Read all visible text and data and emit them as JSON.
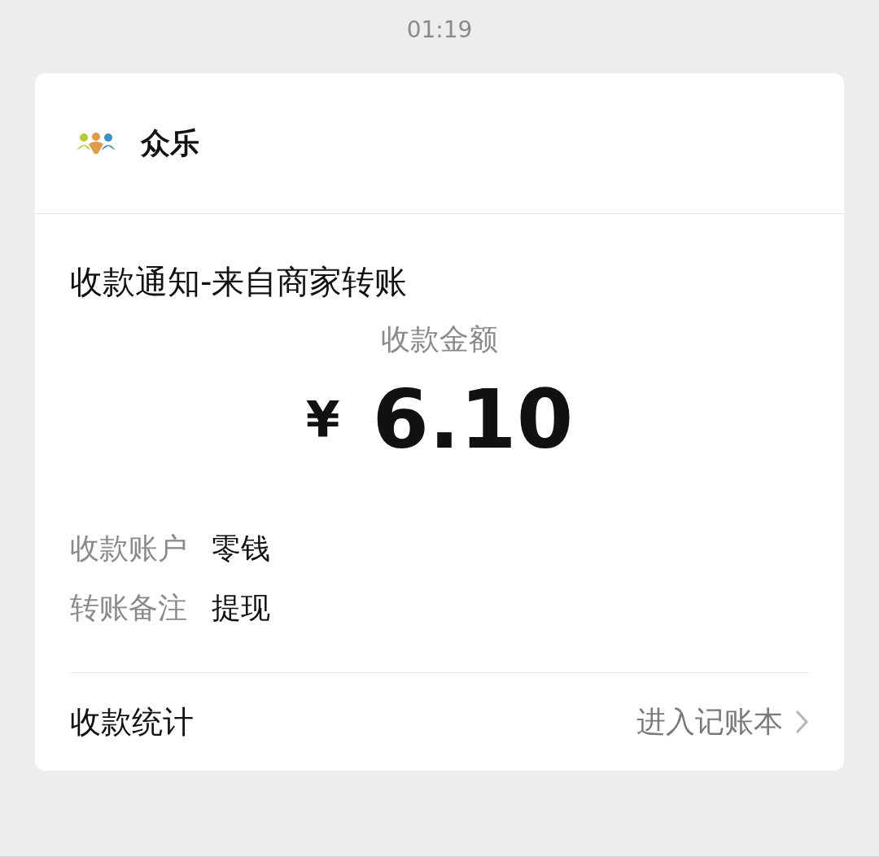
{
  "time": "01:19",
  "card": {
    "sender": "众乐",
    "title": "收款通知-来自商家转账",
    "amount_label": "收款金额",
    "currency": "¥",
    "amount": "6.10",
    "details": [
      {
        "label": "收款账户",
        "value": "零钱"
      },
      {
        "label": "转账备注",
        "value": "提现"
      }
    ],
    "footer": {
      "label": "收款统计",
      "link": "进入记账本"
    }
  }
}
